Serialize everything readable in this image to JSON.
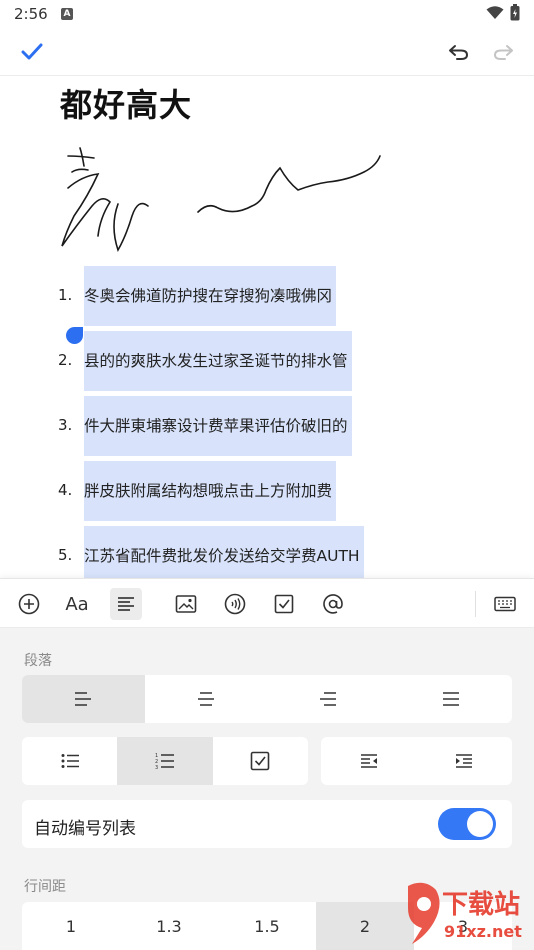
{
  "status": {
    "time": "2:56",
    "notification_letter": "A"
  },
  "document": {
    "title": "都好高大",
    "list_items": [
      {
        "num": "1.",
        "text": "冬奥会佛道防护搜在穿搜狗凑哦佛冈"
      },
      {
        "num": "2.",
        "text": "县的的爽肤水发生过家圣诞节的排水管"
      },
      {
        "num": "3.",
        "text": "件大胖東埔寨设计费苹果评估价破旧的"
      },
      {
        "num": "4.",
        "text": "胖皮肤附属结构想哦点击上方附加费"
      },
      {
        "num": "5.",
        "text": "江苏省配件费批发价发送给交学费AUTH"
      }
    ]
  },
  "toolbar": {
    "icons": [
      "add-circle-icon",
      "font-style-icon",
      "paragraph-format-icon",
      "image-icon",
      "audio-icon",
      "checkbox-icon",
      "mention-icon",
      "keyboard-icon"
    ],
    "font_glyph": "Aa"
  },
  "panel": {
    "paragraph_label": "段落",
    "auto_numbering_label": "自动编号列表",
    "auto_numbering_on": true,
    "line_spacing_label": "行间距",
    "line_spacing_options": [
      "1",
      "1.3",
      "1.5",
      "2",
      "3"
    ],
    "line_spacing_selected": "2"
  },
  "watermark": {
    "brand": "下载站",
    "domain": "91xz.net"
  },
  "colors": {
    "accent": "#2c6ff0",
    "selection": "#d8e3fb",
    "toggle_on": "#3478f6"
  }
}
